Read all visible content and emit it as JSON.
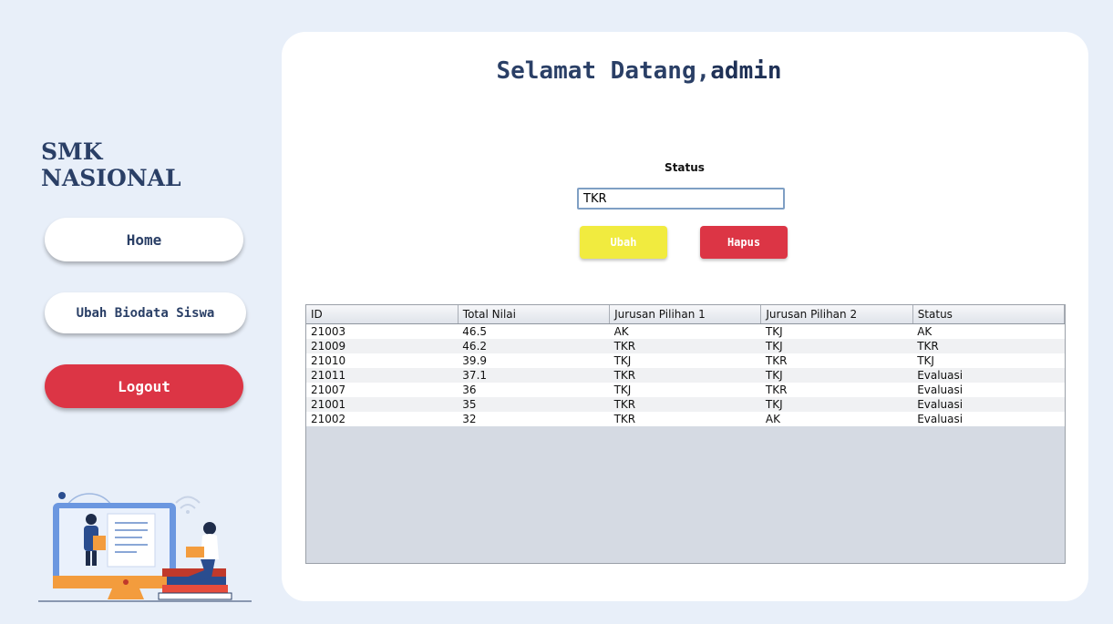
{
  "sidebar": {
    "brand": "SMK NASIONAL",
    "nav": {
      "home": "Home",
      "biodata": "Ubah Biodata Siswa",
      "logout": "Logout"
    }
  },
  "main": {
    "welcome_prefix": "Selamat Datang,",
    "username": "admin",
    "status_label": "Status",
    "status_value": "TKR",
    "buttons": {
      "ubah": "Ubah",
      "hapus": "Hapus"
    },
    "table": {
      "columns": [
        "ID",
        "Total Nilai",
        "Jurusan Pilihan 1",
        "Jurusan Pilihan 2",
        "Status"
      ],
      "rows": [
        [
          "21003",
          "46.5",
          "AK",
          "TKJ",
          "AK"
        ],
        [
          "21009",
          "46.2",
          "TKR",
          "TKJ",
          "TKR"
        ],
        [
          "21010",
          "39.9",
          "TKJ",
          "TKR",
          "TKJ"
        ],
        [
          "21011",
          "37.1",
          "TKR",
          "TKJ",
          "Evaluasi"
        ],
        [
          "21007",
          "36",
          "TKJ",
          "TKR",
          "Evaluasi"
        ],
        [
          "21001",
          "35",
          "TKR",
          "TKJ",
          "Evaluasi"
        ],
        [
          "21002",
          "32",
          "TKR",
          "AK",
          "Evaluasi"
        ]
      ]
    }
  },
  "colors": {
    "background": "#e8eff9",
    "navy": "#2a3f66",
    "danger": "#dc3545",
    "warning": "#f1eb3f"
  },
  "icons": {
    "illustration": "computer-learning-illustration"
  }
}
